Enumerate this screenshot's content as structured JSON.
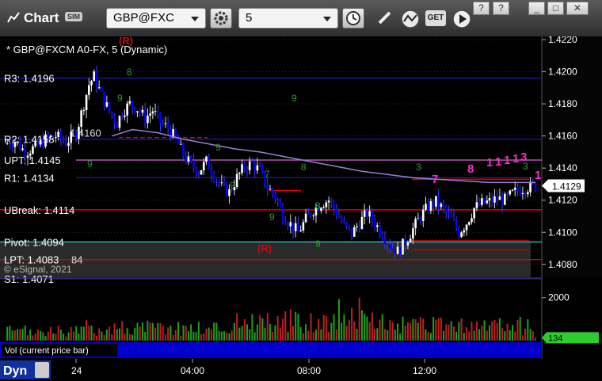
{
  "window": {
    "title": "Chart",
    "badge": "SIM",
    "symbol": "GBP@FXC",
    "interval": "5",
    "help": "?",
    "minimize": "_",
    "maximize": "□",
    "close": "✕"
  },
  "toolbar": {
    "icons": [
      "gear-icon",
      "clock-icon",
      "pencil-icon",
      "line-study-icon",
      "get-icon",
      "play-icon"
    ],
    "get_label": "GET"
  },
  "colors": {
    "background": "#000000",
    "candle_up": "#ffffff",
    "candle_down": "#0000ff",
    "ma_line": "#9a7fd6",
    "pivot_blue": "#1a1aa0",
    "upt_line": "#c060c0",
    "red_lines": "#e00000",
    "volume_up": "#20a020",
    "volume_down": "#c02020",
    "last_price_bg": "#ffffff"
  },
  "price_panel": {
    "header": "* GBP@FXCM A0-FX, 5 (Dynamic)",
    "copyright": "© eSignal, 2021",
    "last_price": "1.4129",
    "y_ticks": [
      "1.4220",
      "1.4200",
      "1.4180",
      "1.4160",
      "1.4140",
      "1.4120",
      "1.4100",
      "1.4080"
    ],
    "levels": [
      {
        "label": "R3: 1.4196",
        "value": 1.4196,
        "color": "#1a1aa0"
      },
      {
        "label": "R2: 1.4158",
        "value": 1.4158,
        "color": "#1a1aa0",
        "partial": "1.4160"
      },
      {
        "label": "UPT: 1.4145",
        "value": 1.4145,
        "color": "#c060c0"
      },
      {
        "label": "R1: 1.4134",
        "value": 1.4134,
        "color": "#1a1aa0"
      },
      {
        "label": "UBreak: 1.4114",
        "value": 1.4114,
        "color": "#e00000"
      },
      {
        "label": "Pivot: 1.4094",
        "value": 1.4094,
        "color": "#30c0c0"
      },
      {
        "label": "LPT: 1.4083",
        "value": 1.4083,
        "color": "#e00000",
        "partial": "84"
      },
      {
        "label": "S1: 1.4071",
        "value": 1.4071,
        "color": "#1a1aa0"
      }
    ],
    "markers": [
      "(R)",
      "(R)"
    ]
  },
  "volume_panel": {
    "label": "Vol (current price bar)",
    "y_tick": "2000",
    "last_value": "134"
  },
  "time_axis": {
    "dyn_label": "Dyn",
    "ticks": [
      "24",
      "04:00",
      "08:00",
      "12:00"
    ]
  },
  "chart_data": {
    "type": "candlestick",
    "instrument": "GBP@FXCM",
    "interval": "5",
    "y_range": [
      1.4072,
      1.4222
    ],
    "x_ticks": [
      "24",
      "04:00",
      "08:00",
      "12:00"
    ],
    "ohlc_close_path": [
      [
        0,
        1.4155
      ],
      [
        4,
        1.4157
      ],
      [
        8,
        1.415
      ],
      [
        12,
        1.4153
      ],
      [
        16,
        1.4158
      ],
      [
        20,
        1.416
      ],
      [
        24,
        1.4156
      ],
      [
        28,
        1.4162
      ],
      [
        31,
        1.418
      ],
      [
        33,
        1.4192
      ],
      [
        35,
        1.4197
      ],
      [
        38,
        1.4185
      ],
      [
        41,
        1.4175
      ],
      [
        44,
        1.4168
      ],
      [
        46,
        1.4175
      ],
      [
        49,
        1.418
      ],
      [
        52,
        1.4177
      ],
      [
        55,
        1.4171
      ],
      [
        58,
        1.4176
      ],
      [
        61,
        1.4168
      ],
      [
        64,
        1.4165
      ],
      [
        67,
        1.4158
      ],
      [
        70,
        1.4148
      ],
      [
        73,
        1.4142
      ],
      [
        76,
        1.4138
      ],
      [
        79,
        1.4144
      ],
      [
        82,
        1.4136
      ],
      [
        85,
        1.4128
      ],
      [
        88,
        1.4125
      ],
      [
        91,
        1.4134
      ],
      [
        94,
        1.4141
      ],
      [
        97,
        1.4143
      ],
      [
        100,
        1.4138
      ],
      [
        103,
        1.4128
      ],
      [
        106,
        1.4122
      ],
      [
        109,
        1.4111
      ],
      [
        112,
        1.4105
      ],
      [
        115,
        1.41
      ],
      [
        118,
        1.4108
      ],
      [
        121,
        1.4114
      ],
      [
        124,
        1.4118
      ],
      [
        127,
        1.412
      ],
      [
        130,
        1.4112
      ],
      [
        133,
        1.4104
      ],
      [
        136,
        1.4099
      ],
      [
        139,
        1.4106
      ],
      [
        142,
        1.4112
      ],
      [
        145,
        1.4106
      ],
      [
        148,
        1.4099
      ],
      [
        151,
        1.4092
      ],
      [
        154,
        1.4088
      ],
      [
        157,
        1.4094
      ],
      [
        160,
        1.4102
      ],
      [
        163,
        1.411
      ],
      [
        166,
        1.4116
      ],
      [
        169,
        1.4119
      ],
      [
        172,
        1.4114
      ],
      [
        175,
        1.4108
      ],
      [
        178,
        1.41
      ],
      [
        181,
        1.4106
      ],
      [
        184,
        1.4115
      ],
      [
        187,
        1.4118
      ],
      [
        190,
        1.4119
      ],
      [
        193,
        1.4121
      ],
      [
        196,
        1.412
      ],
      [
        199,
        1.4124
      ],
      [
        202,
        1.4127
      ],
      [
        205,
        1.4128
      ],
      [
        208,
        1.4129
      ]
    ],
    "ma_path": [
      [
        42,
        1.416
      ],
      [
        50,
        1.4164
      ],
      [
        60,
        1.4162
      ],
      [
        70,
        1.4158
      ],
      [
        80,
        1.4155
      ],
      [
        90,
        1.4152
      ],
      [
        100,
        1.415
      ],
      [
        110,
        1.4147
      ],
      [
        120,
        1.4144
      ],
      [
        130,
        1.4141
      ],
      [
        140,
        1.4138
      ],
      [
        150,
        1.4136
      ],
      [
        160,
        1.4134
      ],
      [
        170,
        1.4133
      ],
      [
        180,
        1.4132
      ],
      [
        190,
        1.4131
      ],
      [
        200,
        1.4131
      ],
      [
        208,
        1.4131
      ]
    ],
    "volume_y_range": [
      0,
      2800
    ],
    "volume_tick": 2000,
    "last_volume": 134
  }
}
